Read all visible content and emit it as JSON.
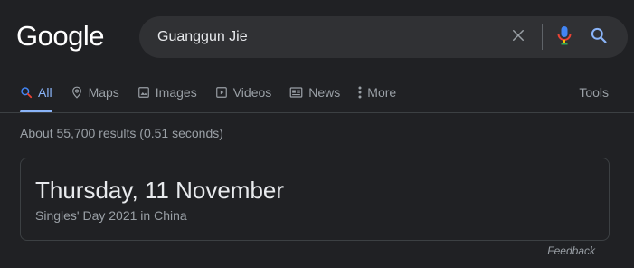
{
  "header": {
    "logo_text": "Google",
    "search": {
      "value": "Guanggun Jie",
      "clear_icon": "close-icon",
      "mic_icon": "microphone-icon",
      "search_icon": "search-icon"
    }
  },
  "tabs": {
    "items": [
      {
        "label": "All",
        "icon": "search-icon",
        "active": true
      },
      {
        "label": "Maps",
        "icon": "map-pin-icon"
      },
      {
        "label": "Images",
        "icon": "image-icon"
      },
      {
        "label": "Videos",
        "icon": "video-icon"
      },
      {
        "label": "News",
        "icon": "news-icon"
      },
      {
        "label": "More",
        "icon": "more-vertical-icon"
      }
    ],
    "tools_label": "Tools"
  },
  "results": {
    "stats": "About 55,700 results (0.51 seconds)"
  },
  "answer_card": {
    "title": "Thursday, 11 November",
    "subtitle": "Singles' Day 2021 in China"
  },
  "feedback_label": "Feedback",
  "colors": {
    "background": "#202124",
    "surface": "#303134",
    "accent": "#8ab4f8",
    "text_primary": "#e8eaed",
    "text_secondary": "#9aa0a6"
  }
}
